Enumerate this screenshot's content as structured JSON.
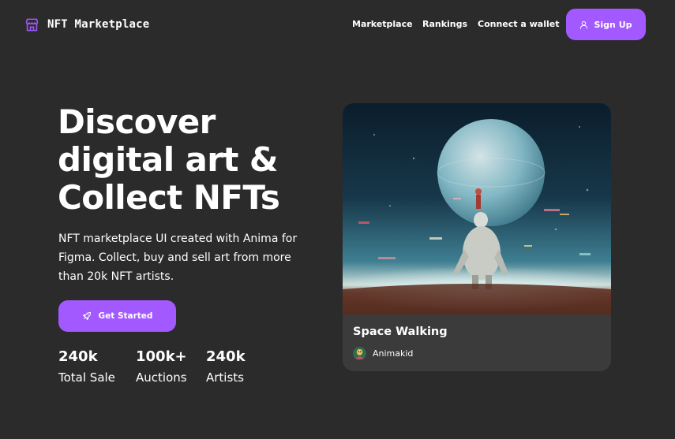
{
  "brand": {
    "name": "NFT Marketplace",
    "icon": "storefront-icon",
    "accent": "#a259ff"
  },
  "nav": {
    "links": [
      "Marketplace",
      "Rankings",
      "Connect a wallet"
    ],
    "signup_label": "Sign Up",
    "signup_icon": "user-icon"
  },
  "hero": {
    "title_lines": [
      "Discover",
      "digital art &",
      "Collect NFTs"
    ],
    "description_lines": [
      "NFT marketplace UI created with Anima for",
      "Figma. Collect, buy and sell art from more",
      "than 20k NFT artists."
    ],
    "cta_label": "Get Started",
    "cta_icon": "rocket-icon",
    "stats": [
      {
        "value": "240k",
        "label": "Total Sale"
      },
      {
        "value": "100k+",
        "label": "Auctions"
      },
      {
        "value": "240k",
        "label": "Artists"
      }
    ]
  },
  "featured": {
    "title": "Space Walking",
    "artist": "Animakid"
  },
  "colors": {
    "background": "#2b2b2b",
    "card": "#3b3b3b",
    "text": "#ffffff"
  }
}
